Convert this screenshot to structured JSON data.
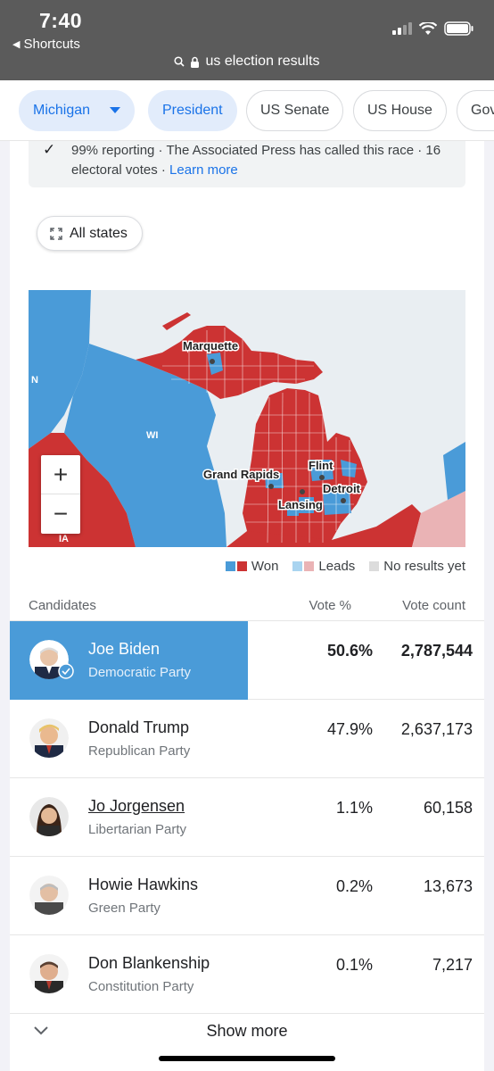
{
  "status_bar": {
    "time": "7:40",
    "back_label": "Shortcuts",
    "url": "us election results"
  },
  "chips": [
    {
      "label": "Michigan",
      "active": true,
      "dropdown": true
    },
    {
      "label": "President",
      "active": true
    },
    {
      "label": "US Senate",
      "active": false
    },
    {
      "label": "US House",
      "active": false
    },
    {
      "label": "Gov",
      "active": false
    }
  ],
  "info": {
    "text": "99% reporting · The Associated Press has called this race · 16 electoral votes · ",
    "link": "Learn more"
  },
  "all_states_label": "All states",
  "map": {
    "labels": {
      "marquette": "Marquette",
      "grand_rapids": "Grand Rapids",
      "flint": "Flint",
      "detroit": "Detroit",
      "lansing": "Lansing",
      "wi": "WI",
      "ia": "IA",
      "mn": "N"
    },
    "colors": {
      "dem_won": "#4a9bd8",
      "rep_won": "#cc3333",
      "dem_leads": "#a9d4f0",
      "rep_leads": "#eab3b5",
      "no_results": "#dcdcdc",
      "lake": "#e9eef2"
    }
  },
  "legend": {
    "won": "Won",
    "leads": "Leads",
    "no_results": "No results yet"
  },
  "table": {
    "headers": {
      "candidates": "Candidates",
      "vote_pct": "Vote %",
      "vote_count": "Vote count"
    },
    "rows": [
      {
        "name": "Joe Biden",
        "party": "Democratic Party",
        "pct": "50.6%",
        "count": "2,787,544",
        "winner": true
      },
      {
        "name": "Donald Trump",
        "party": "Republican Party",
        "pct": "47.9%",
        "count": "2,637,173"
      },
      {
        "name": "Jo Jorgensen",
        "party": "Libertarian Party",
        "pct": "1.1%",
        "count": "60,158"
      },
      {
        "name": "Howie Hawkins",
        "party": "Green Party",
        "pct": "0.2%",
        "count": "13,673"
      },
      {
        "name": "Don Blankenship",
        "party": "Constitution Party",
        "pct": "0.1%",
        "count": "7,217"
      }
    ]
  },
  "show_more": "Show more"
}
